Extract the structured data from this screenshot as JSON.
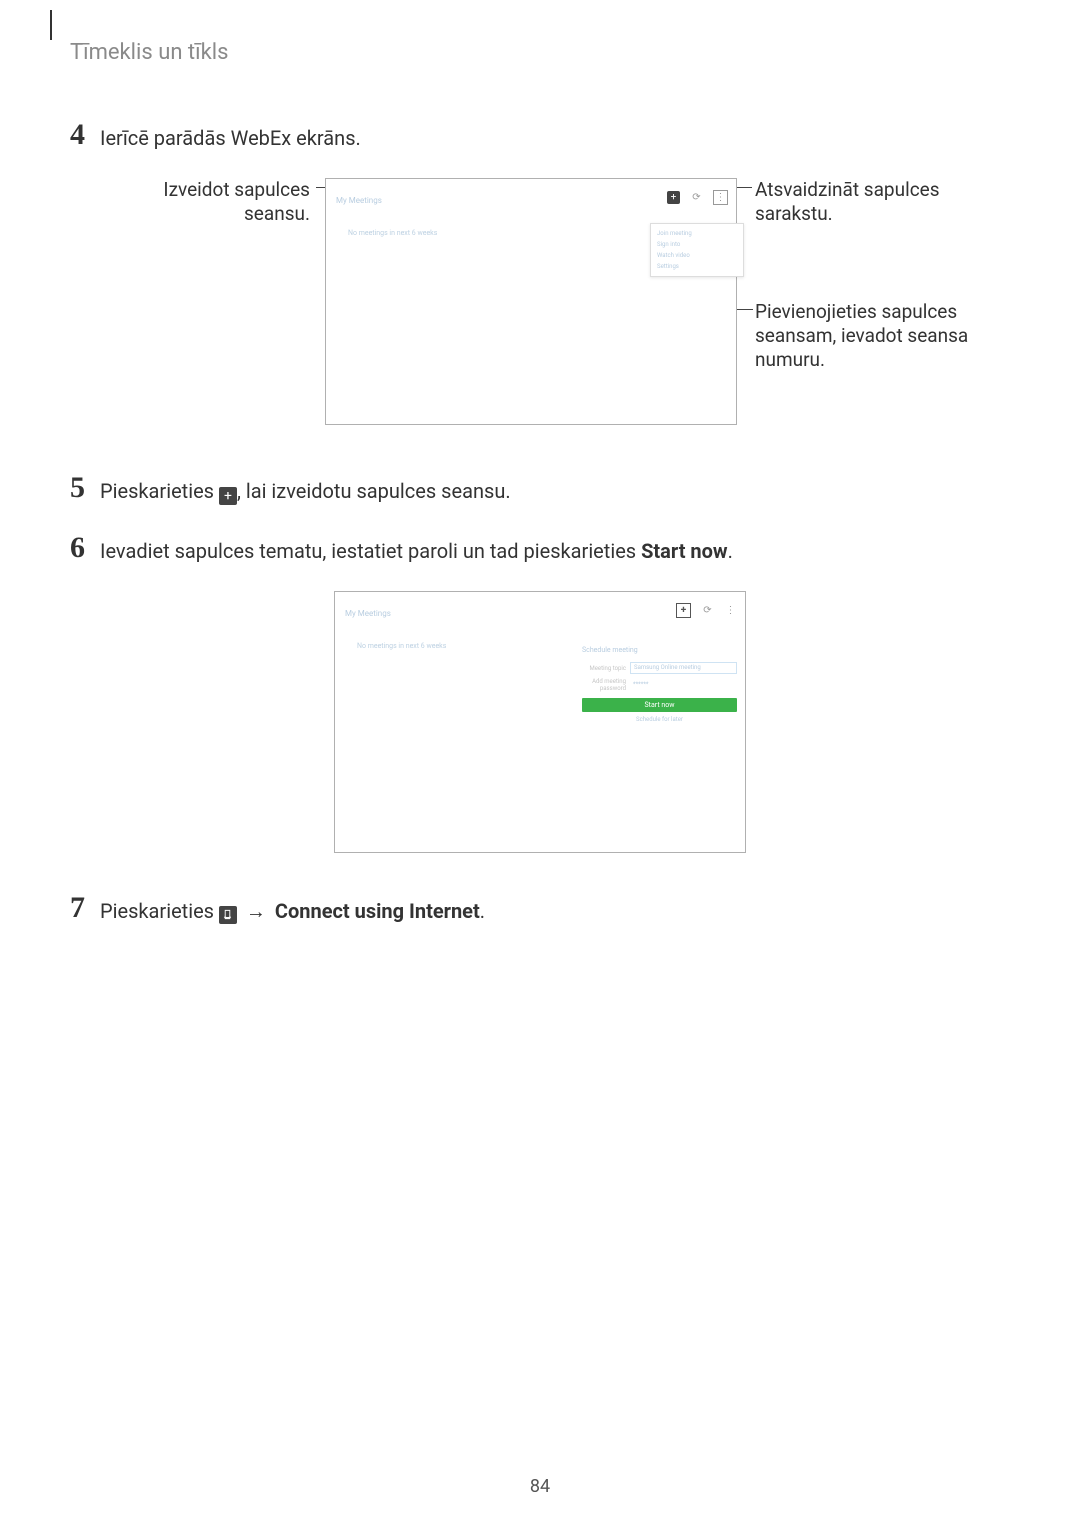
{
  "section_title": "Tīmeklis un tīkls",
  "steps": {
    "s4": {
      "num": "4",
      "text": "Ierīcē parādās WebEx ekrāns."
    },
    "s5": {
      "num": "5",
      "text_before": "Pieskarieties ",
      "text_after": ", lai izveidotu sapulces seansu."
    },
    "s6": {
      "num": "6",
      "text_before": "Ievadiet sapulces tematu, iestatiet paroli un tad pieskarieties ",
      "bold": "Start now",
      "text_after": "."
    },
    "s7": {
      "num": "7",
      "text_before": "Pieskarieties ",
      "arrow": " → ",
      "bold": "Connect using Internet",
      "text_after": "."
    }
  },
  "fig1": {
    "callout_left": "Izveidot sapulces seansu.",
    "callout_right_1": "Atsvaidzināt sapulces sarakstu.",
    "callout_right_2": "Pievienojieties sapulces seansam, ievadot seansa numuru.",
    "screen_title": "My Meetings",
    "body_text": "No meetings in next 6 weeks",
    "menu": [
      "Join meeting",
      "Sign into",
      "Watch video",
      "Settings"
    ]
  },
  "fig2": {
    "screen_title": "My Meetings",
    "left_text": "No meetings in next 6 weeks",
    "form_title": "Schedule meeting",
    "rows": [
      {
        "lbl": "Meeting topic",
        "val": "Samsung Online meeting"
      },
      {
        "lbl": "Add meeting password",
        "val": "******"
      }
    ],
    "btn": "Start now",
    "sched": "Schedule for later"
  },
  "page_number": "84"
}
